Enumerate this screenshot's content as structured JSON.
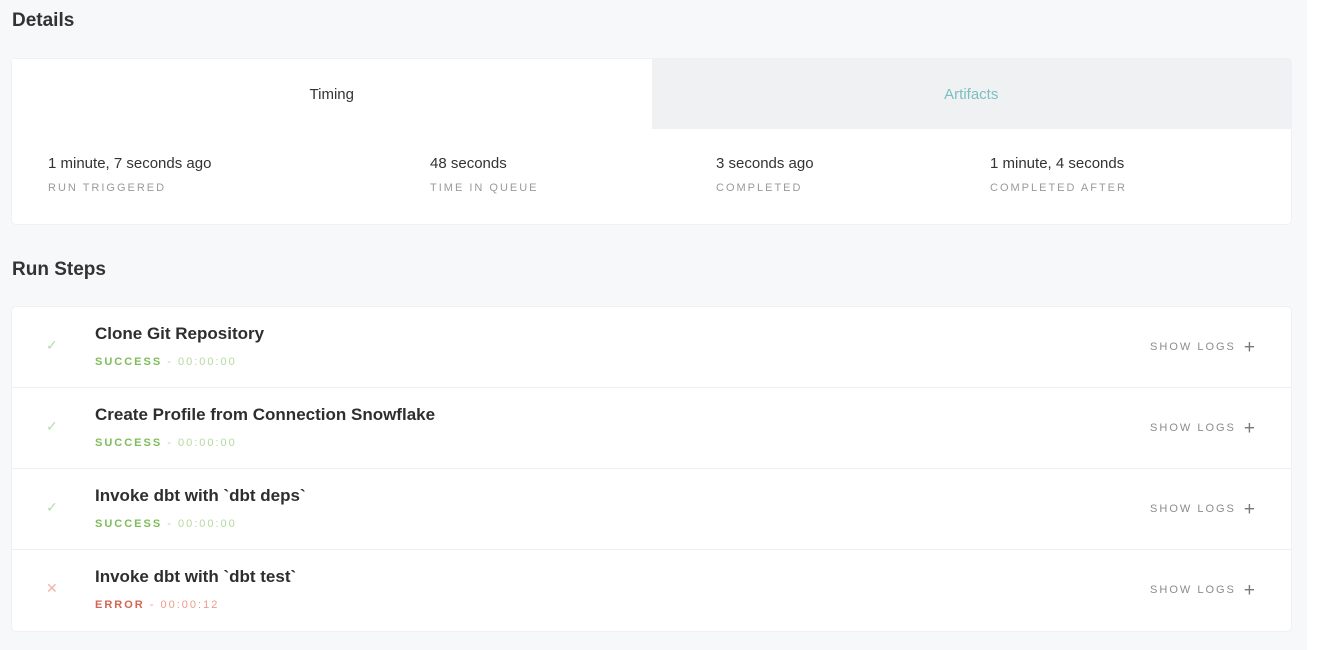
{
  "details": {
    "title": "Details",
    "tabs": [
      {
        "label": "Timing"
      },
      {
        "label": "Artifacts"
      }
    ],
    "stats": [
      {
        "value": "1 minute, 7 seconds ago",
        "label": "RUN TRIGGERED"
      },
      {
        "value": "48 seconds",
        "label": "TIME IN QUEUE"
      },
      {
        "value": "3 seconds ago",
        "label": "COMPLETED"
      },
      {
        "value": "1 minute, 4 seconds",
        "label": "COMPLETED AFTER"
      }
    ]
  },
  "run_steps": {
    "title": "Run Steps",
    "show_logs_label": "SHOW LOGS",
    "steps": [
      {
        "title": "Clone Git Repository",
        "status": "SUCCESS",
        "duration": "- 00:00:00",
        "icon": "checkmark-icon"
      },
      {
        "title": "Create Profile from Connection Snowflake",
        "status": "SUCCESS",
        "duration": "- 00:00:00",
        "icon": "checkmark-icon"
      },
      {
        "title": "Invoke dbt with `dbt deps`",
        "status": "SUCCESS",
        "duration": "- 00:00:00",
        "icon": "checkmark-icon"
      },
      {
        "title": "Invoke dbt with `dbt test`",
        "status": "ERROR",
        "duration": "- 00:00:12",
        "icon": "cross-icon"
      }
    ]
  },
  "colors": {
    "success": "#7dbd5a",
    "error": "#d36553",
    "tab_inactive_text": "#7bbfc3"
  }
}
